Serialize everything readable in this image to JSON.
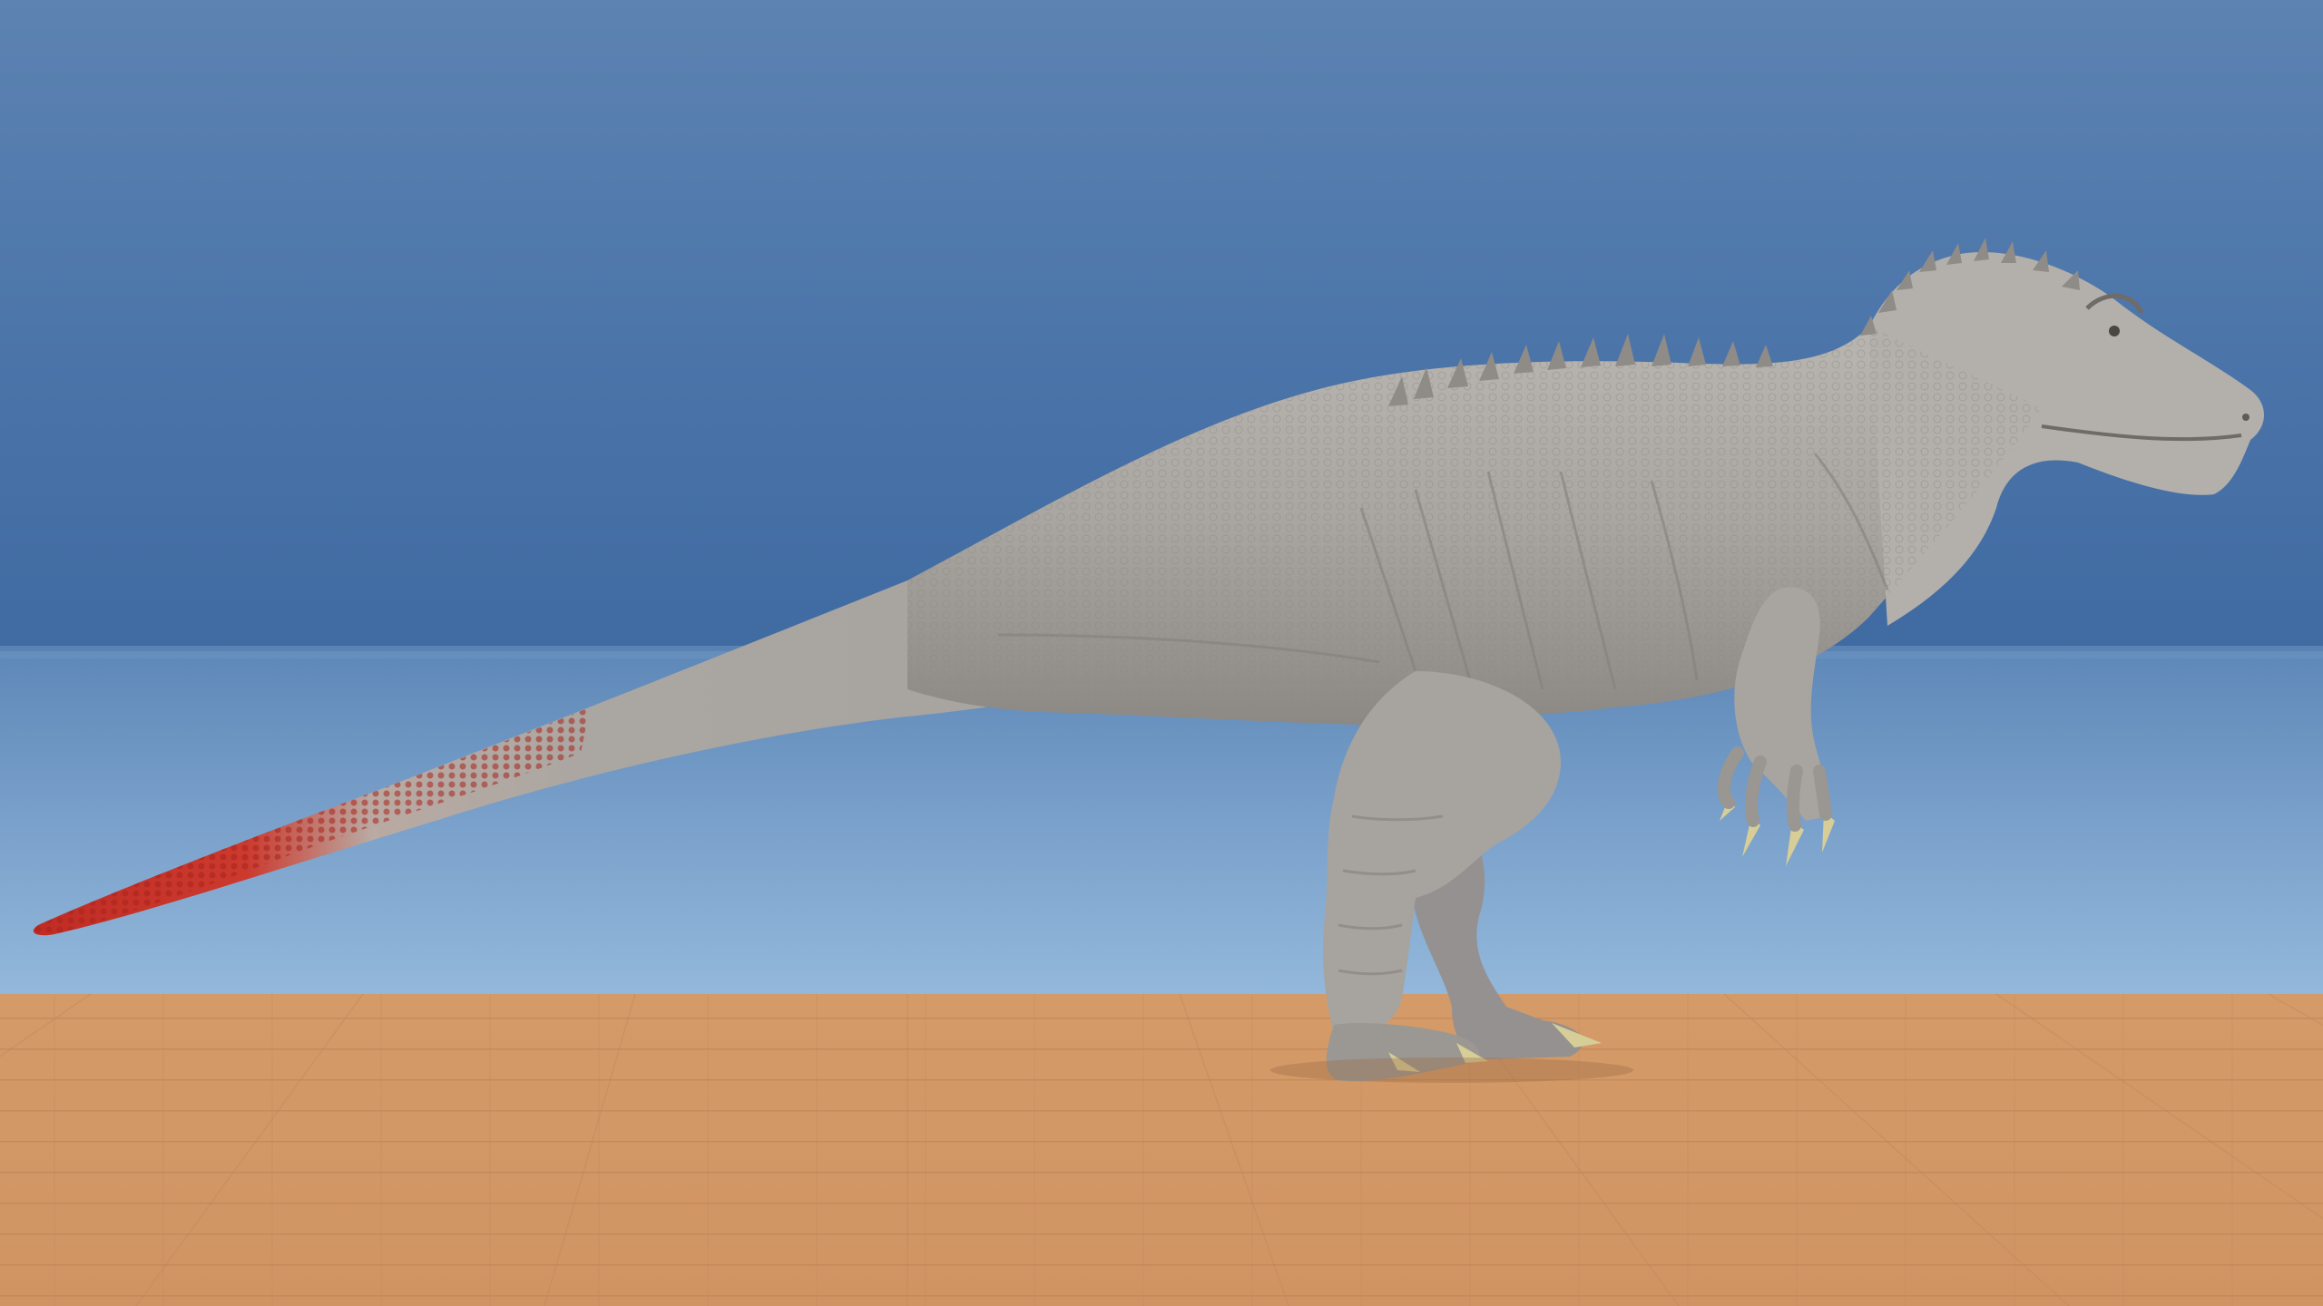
{
  "scene": {
    "subject": "dinosaur",
    "colors": {
      "sky_top": "#5a80ad",
      "sky_mid": "#4a73a8",
      "sky_horizon": "#3d6aa0",
      "sea_top": "#6f97c2",
      "sea_bottom": "#8fb4d8",
      "ground_light": "#d8a16d",
      "ground_dark": "#c4875a",
      "skin_light": "#b9b6b2",
      "skin_mid": "#a19d99",
      "skin_dark": "#7f7b77",
      "tail_red": "#c93228",
      "claw": "#d8cf9a"
    }
  }
}
